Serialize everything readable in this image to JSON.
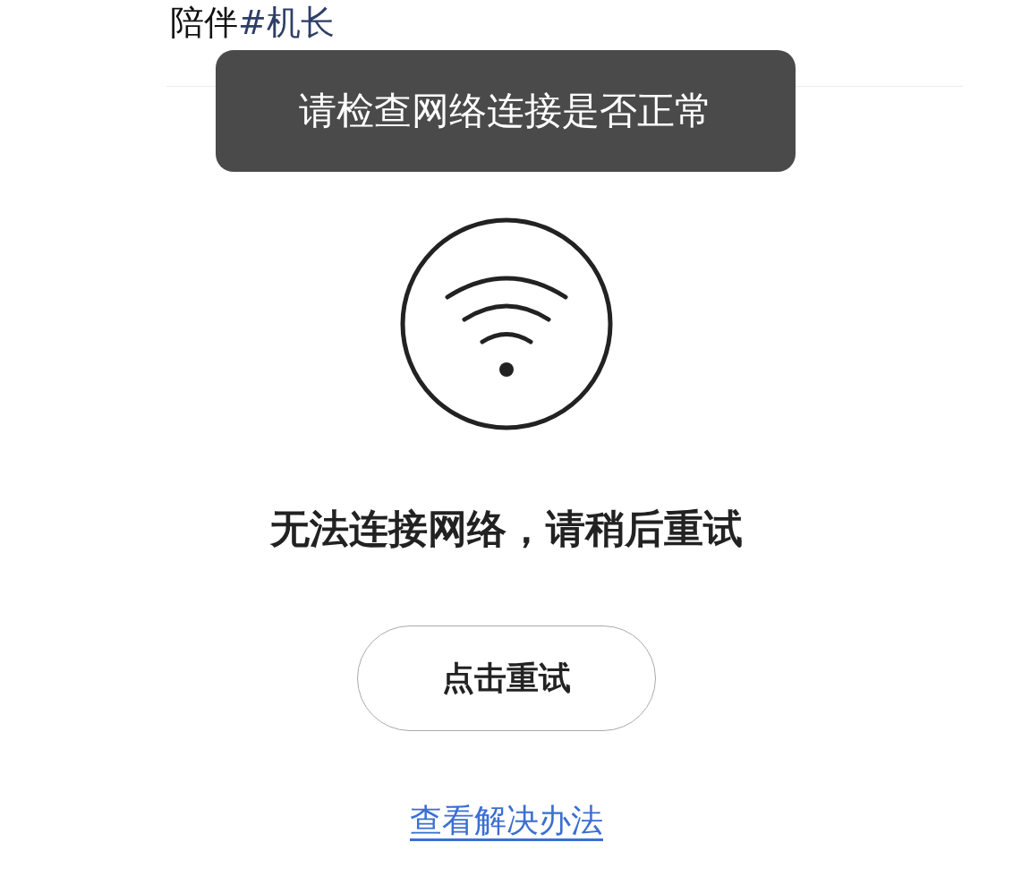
{
  "header": {
    "title": "陪伴",
    "hashtag": "#机长"
  },
  "toast": {
    "message": "请检查网络连接是否正常"
  },
  "error": {
    "heading": "无法连接网络，请稍后重试",
    "retry_button": "点击重试",
    "help_link": "查看解决办法"
  }
}
